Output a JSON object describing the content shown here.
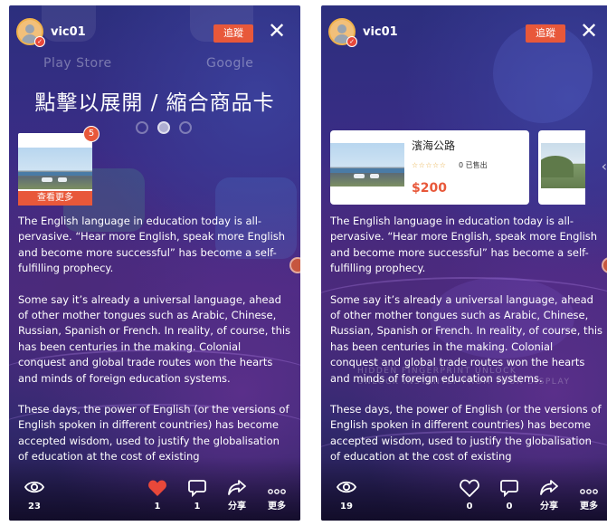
{
  "left": {
    "username": "vic01",
    "follow_label": "追蹤",
    "close_glyph": "✕",
    "bg_app_labels": [
      "Play Store",
      "Google"
    ],
    "overlay_title": "點擊以展開 / 縮合商品卡",
    "mini_card": {
      "badge": "5",
      "more_label": "查看更多"
    },
    "article": [
      "The English language in education today is all-pervasive. “Hear more English, speak more English and become more successful” has become a self-fulfilling prophecy.",
      "Some say it’s already a universal language, ahead of other mother tongues such as Arabic, Chinese, Russian, Spanish or French. In reality, of course, this has been centuries in the making. Colonial conquest and global trade routes won the hearts and minds of foreign education systems.",
      "These days, the power of English (or the versions of English spoken in different countries) has become accepted wisdom, used to justify the globalisation of education at the cost of existing"
    ],
    "bar": {
      "views": "23",
      "likes": "1",
      "comments": "1",
      "share_label": "分享",
      "more_label": "更多"
    }
  },
  "right": {
    "username": "vic01",
    "follow_label": "追蹤",
    "close_glyph": "✕",
    "product": {
      "name": "濱海公路",
      "stars": "☆☆☆☆☆",
      "sold": "0 已售出",
      "price": "$200"
    },
    "watermark": [
      "HIDDEN FINGERPRINT UNLOCK",
      "UNLOCK INSTANTLY FROM YOUR DISPLAY"
    ],
    "article": [
      "The English language in education today is all-pervasive. “Hear more English, speak more English and become more successful” has become a self-fulfilling prophecy.",
      "Some say it’s already a universal language, ahead of other mother tongues such as Arabic, Chinese, Russian, Spanish or French. In reality, of course, this has been centuries in the making. Colonial conquest and global trade routes won the hearts and minds of foreign education systems.",
      "These days, the power of English (or the versions of English spoken in different countries) has become accepted wisdom, used to justify the globalisation of education at the cost of existing"
    ],
    "bar": {
      "views": "19",
      "likes": "0",
      "comments": "0",
      "share_label": "分享",
      "more_label": "更多"
    }
  },
  "colors": {
    "accent": "#e8583a",
    "like_active": "#e8483a",
    "text": "#ffffff"
  },
  "icons": [
    "eye-icon",
    "heart-icon",
    "comment-icon",
    "share-icon",
    "more-dots-icon",
    "close-icon",
    "chevron-left-icon",
    "avatar-verified-badge-icon"
  ]
}
